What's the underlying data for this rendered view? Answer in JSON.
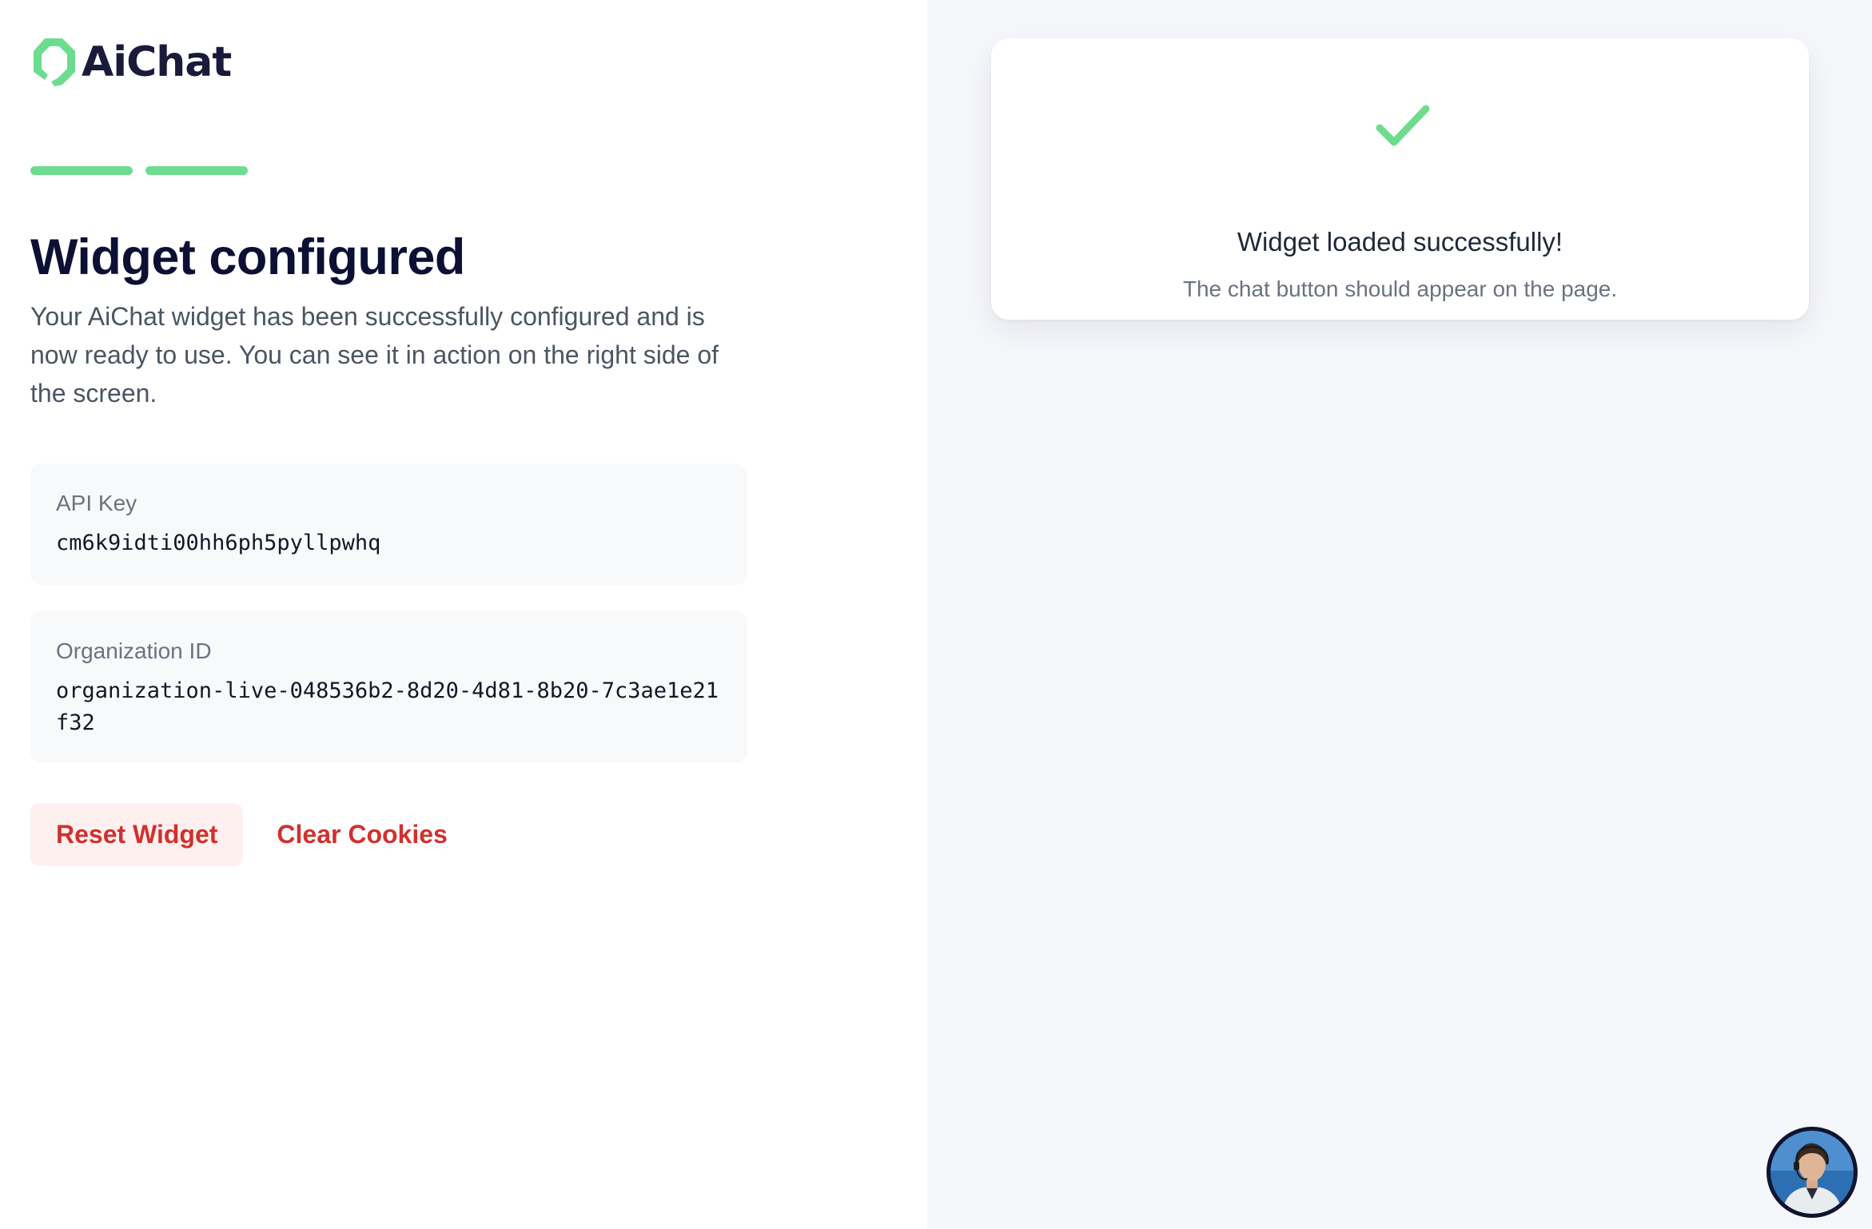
{
  "brand": {
    "name": "AiChat"
  },
  "progress": {
    "steps_total": 2,
    "steps_completed": 2
  },
  "main": {
    "title": "Widget configured",
    "description": "Your AiChat widget has been successfully configured and is now ready to use. You can see it in action on the right side of the screen."
  },
  "fields": {
    "api_key": {
      "label": "API Key",
      "value": "cm6k9idti00hh6ph5pyllpwhq"
    },
    "organization_id": {
      "label": "Organization ID",
      "value": "organization-live-048536b2-8d20-4d81-8b20-7c3ae1e21f32"
    }
  },
  "actions": {
    "reset_label": "Reset Widget",
    "clear_label": "Clear Cookies"
  },
  "preview": {
    "title": "Widget loaded successfully!",
    "subtitle": "The chat button should appear on the page.",
    "icon": "check-icon"
  },
  "chat_launcher": {
    "icon": "agent-avatar"
  },
  "colors": {
    "accent": "#6ddc8f",
    "heading": "#0c1034",
    "danger": "#d0312d",
    "danger_bg": "#fdf0ef",
    "right_panel_bg": "#f6f7fb"
  }
}
